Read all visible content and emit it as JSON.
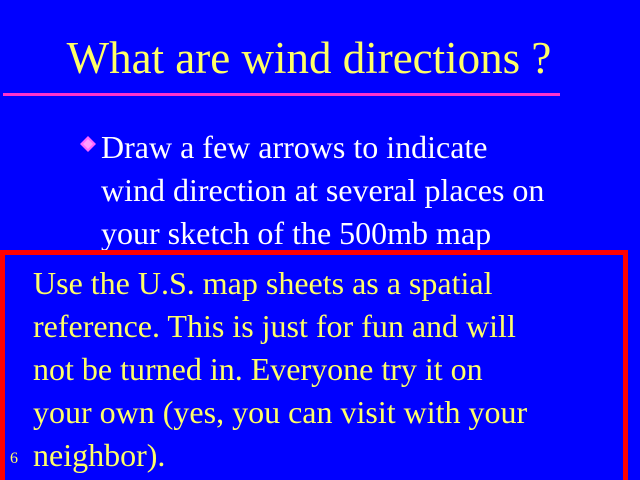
{
  "slide": {
    "title": "What are wind directions ?",
    "bullet": {
      "icon": "diamond-bullet-icon",
      "text": "Draw a few arrows to indicate\nwind direction at several places on\nyour sketch of the 500mb map"
    },
    "note": {
      "text": "Use the U.S. map sheets as a spatial\nreference. This is just for fun and will\nnot be turned in. Everyone try it on\nyour own (yes, you can visit with your\nneighbor)."
    },
    "page_number": "6"
  },
  "colors": {
    "background": "#0000ff",
    "title": "#ffff66",
    "rule": "#ff33cc",
    "bullet_text": "#ffffff",
    "bullet_mark": "#ff66ff",
    "note_border": "#ff0000",
    "note_text": "#ffff66"
  }
}
